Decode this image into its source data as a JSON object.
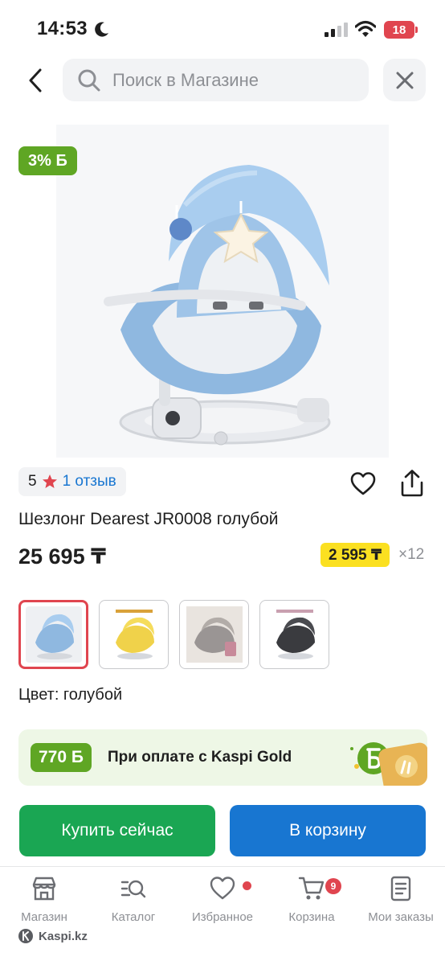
{
  "status_bar": {
    "time": "14:53",
    "battery": "18"
  },
  "search": {
    "placeholder": "Поиск в Магазине"
  },
  "product": {
    "bonus_badge": "3% Б",
    "rating": "5",
    "reviews": "1 отзыв",
    "title": "Шезлонг Dearest JR0008 голубой",
    "price": "25 695 ₸",
    "installment_price": "2 595 ₸",
    "installment_months": "×12",
    "color_label": "Цвет: голубой",
    "variants": [
      {
        "name": "голубой",
        "selected": true
      },
      {
        "name": "желтый",
        "selected": false
      },
      {
        "name": "серый",
        "selected": false
      },
      {
        "name": "черный",
        "selected": false
      }
    ]
  },
  "kaspi_gold": {
    "bonus": "770 Б",
    "text": "При оплате с Kaspi Gold"
  },
  "actions": {
    "buy_now": "Купить сейчас",
    "add_to_cart": "В корзину"
  },
  "nav": {
    "items": [
      {
        "label": "Магазин",
        "icon": "store-icon"
      },
      {
        "label": "Каталог",
        "icon": "catalog-search-icon"
      },
      {
        "label": "Избранное",
        "icon": "heart-icon"
      },
      {
        "label": "Корзина",
        "icon": "cart-icon",
        "badge": "9"
      },
      {
        "label": "Мои заказы",
        "icon": "orders-icon"
      }
    ]
  },
  "footer": {
    "brand": "Kaspi.kz"
  },
  "colors": {
    "green": "#5fa624",
    "buy_green": "#1aa653",
    "blue": "#1876d1",
    "yellow": "#fbe021",
    "red": "#e0454f"
  }
}
